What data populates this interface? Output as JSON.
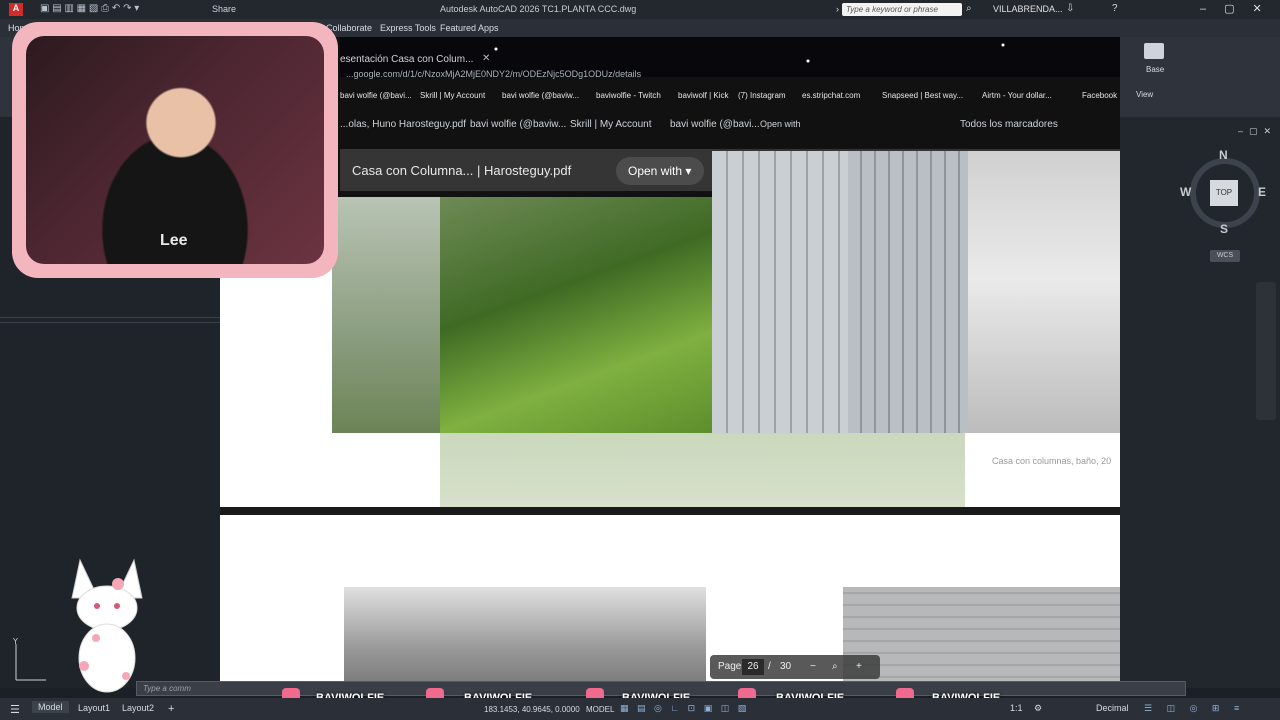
{
  "titlebar": {
    "app_title": "Autodesk AutoCAD 2026   TC1.PLANTA CCC.dwg",
    "share_label": "Share",
    "search_placeholder": "Type a keyword or phrase",
    "user_name": "VILLABRENDA..."
  },
  "ribbon": {
    "tabs": [
      "Home",
      "Collaborate",
      "Express Tools",
      "Featured Apps"
    ],
    "right_panel_label": "Base",
    "view_label": "View"
  },
  "browser": {
    "tab_title": "esentación Casa con Colum...",
    "url": "...google.com/d/1/c/NzoxMjA2MjE0NDY2/m/ODEzNjc5ODg1ODUz/details",
    "bookmarks": [
      "bavi wolfie (@bavi...",
      "Skrill | My Account",
      "bavi wolfie (@baviw...",
      "baviwolfie - Twitch",
      "baviwolf | Kick",
      "(7) Instagram",
      "es.stripchat.com",
      "Snapseed | Best way...",
      "Airtm - Your dollar...",
      "Facebook"
    ],
    "bookmarks_row2": [
      "...olas, Huno Harosteguy.pdf",
      "bavi wolfie (@baviw...",
      "Skrill | My Account",
      "bavi wolfie (@bavi...",
      "Open with",
      "Todos los marcadores"
    ],
    "pdf_title": "Casa con Columna... | Harosteguy.pdf",
    "open_with_label": "Open with",
    "caption": "Casa con columnas, baño, 20",
    "page_label": "Page",
    "page_current": "26",
    "page_separator": "/",
    "page_total": "30"
  },
  "webcam": {
    "shirt_text": "Lee"
  },
  "viewcube": {
    "north": "N",
    "south": "S",
    "east": "E",
    "west": "W",
    "top": "TOP",
    "wcs": "WCS"
  },
  "command_placeholder": "Type a comm",
  "statusbar": {
    "tabs": [
      "Model",
      "Layout1",
      "Layout2"
    ],
    "coords": "183.1453, 40.9645, 0.0000",
    "model_label": "MODEL",
    "units": "Decimal",
    "scale": "1:1"
  },
  "social": {
    "handles": [
      "BAVIWOLFIE",
      "BAVIWOLFIE",
      "BAVIWOLFIE",
      "BAVIWOLFIE",
      "BAVIWOLFIE"
    ]
  },
  "colors": {
    "autocad_bg": "#1b1f26",
    "webcam_frame": "#f3b6bf",
    "social_pink": "#f06a8e"
  }
}
